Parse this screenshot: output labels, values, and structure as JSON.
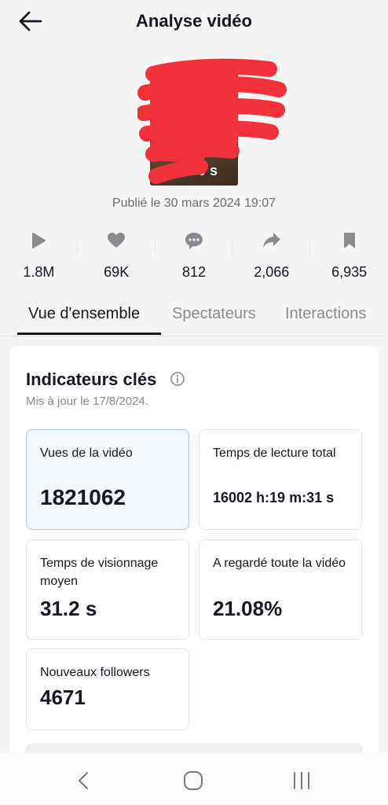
{
  "header": {
    "title": "Analyse vidéo",
    "back_icon": "arrow-left-icon"
  },
  "video": {
    "duration": "70.30 s",
    "published": "Publié le 30 mars 2024 19:07"
  },
  "stats": [
    {
      "icon": "play-icon",
      "value": "1.8M"
    },
    {
      "icon": "heart-icon",
      "value": "69K"
    },
    {
      "icon": "comment-icon",
      "value": "812"
    },
    {
      "icon": "share-icon",
      "value": "2,066"
    },
    {
      "icon": "bookmark-icon",
      "value": "6,935"
    }
  ],
  "tabs": [
    {
      "label": "Vue d'ensemble",
      "active": true
    },
    {
      "label": "Spectateurs",
      "active": false
    },
    {
      "label": "Interactions",
      "active": false
    }
  ],
  "card": {
    "title": "Indicateurs clés",
    "updated": "Mis à jour le 17/8/2024.",
    "metrics": [
      {
        "label": "Vues de la vidéo",
        "value": "1821062",
        "selected": true
      },
      {
        "label": "Temps de lecture total",
        "value": "16002 h:19 m:31 s",
        "selected": false
      },
      {
        "label": "Temps de visionnage moyen",
        "value": "31.2 s",
        "selected": false
      },
      {
        "label": "A regardé toute la vidéo",
        "value": "21.08%",
        "selected": false
      },
      {
        "label": "Nouveaux followers",
        "value": "4671",
        "selected": false
      }
    ]
  },
  "colors": {
    "text": "#161823",
    "muted": "#8a8b91",
    "icon": "#8a8b91",
    "redaction": "#f2313a",
    "selected_bg": "#f3f8fc",
    "selected_border": "#a9cbe0"
  },
  "system_nav": {
    "back": "system-back-icon",
    "home": "system-home-icon",
    "recents": "system-recents-icon"
  }
}
